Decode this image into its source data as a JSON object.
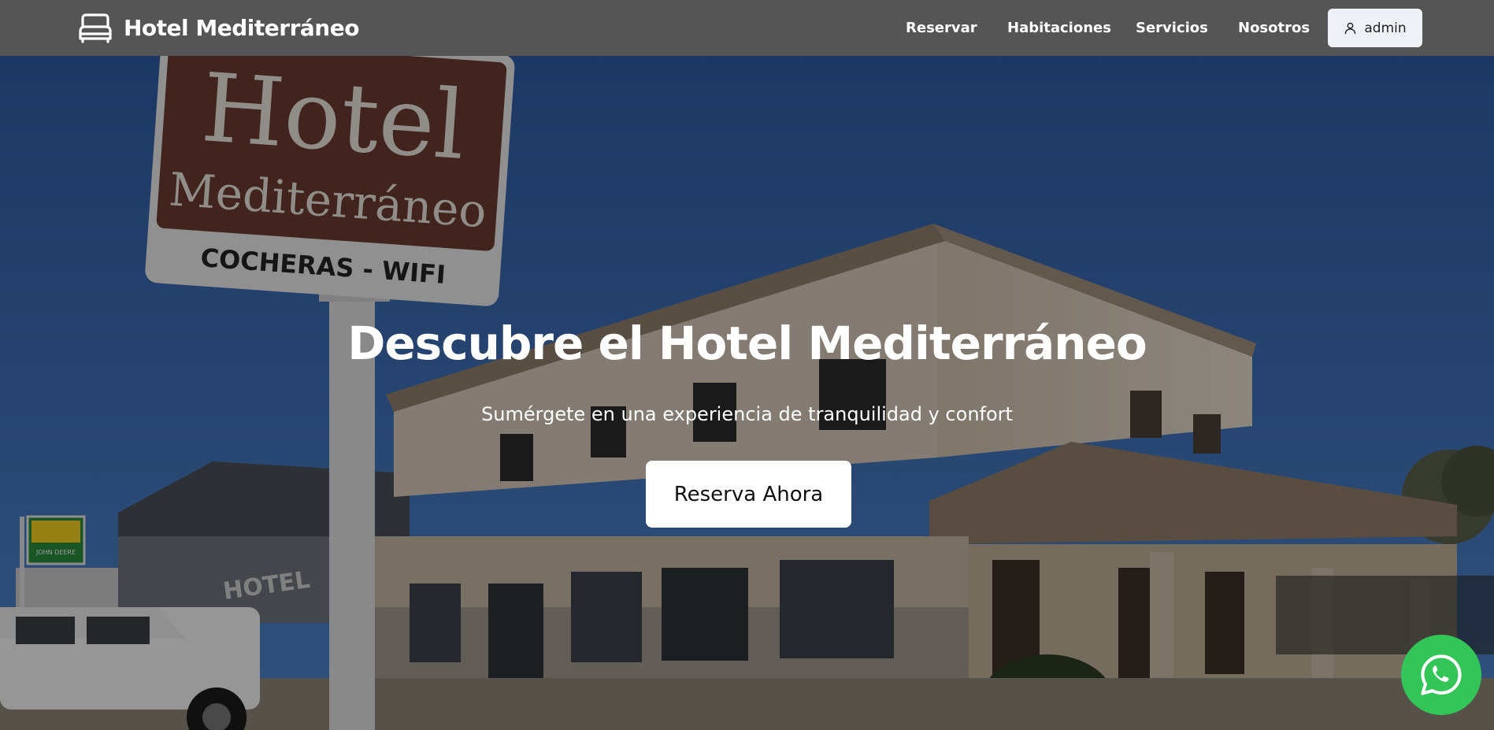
{
  "navbar": {
    "brand_name": "Hotel Mediterráneo",
    "brand_icon": "bed-icon",
    "links": [
      {
        "label": "Reservar"
      },
      {
        "label": "Habitaciones"
      },
      {
        "label": "Servicios"
      },
      {
        "label": "Nosotros"
      }
    ],
    "user": {
      "label": "admin",
      "icon": "user-icon"
    }
  },
  "hero": {
    "title": "Descubre el Hotel Mediterráneo",
    "subtitle": "Sumérgete en una experiencia de tranquilidad y confort",
    "cta_label": "Reserva Ahora",
    "sign": {
      "line1": "Hotel",
      "line2": "Mediterráneo",
      "line3": "COCHERAS - WIFI"
    },
    "building_sign": "HOTEL",
    "dealer_sign": "JOHN DEERE"
  },
  "whatsapp": {
    "icon": "whatsapp-icon",
    "color": "#34c559"
  },
  "colors": {
    "navbar": "#555555",
    "hero_overlay": "rgba(0,0,0,0.38)",
    "button_bg": "#ffffff"
  }
}
